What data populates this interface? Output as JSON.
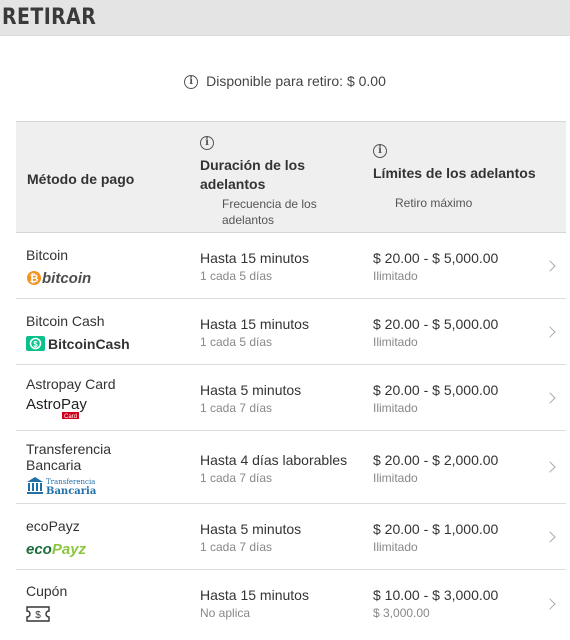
{
  "header": {
    "title": "RETIRAR"
  },
  "available": {
    "icon": "info-icon",
    "text": "Disponible para retiro: $ 0.00"
  },
  "table": {
    "columns": {
      "method": "Método de pago",
      "duration": "Duración de los adelantos",
      "duration_sub": "Frecuencia de los adelantos",
      "limits": "Límites de los adelantos",
      "limits_sub": "Retiro máximo"
    },
    "rows": [
      {
        "name": "Bitcoin",
        "logo": "bitcoin-logo",
        "duration": "Hasta 15 minutos",
        "frequency": "1 cada 5 días",
        "limits": "$ 20.00 - $ 5,000.00",
        "max": "Ilimitado"
      },
      {
        "name": "Bitcoin Cash",
        "logo": "bitcoincash-logo",
        "duration": "Hasta 15 minutos",
        "frequency": "1 cada 5 días",
        "limits": "$ 20.00 - $ 5,000.00",
        "max": "Ilimitado"
      },
      {
        "name": "Astropay Card",
        "logo": "astropay-logo",
        "duration": "Hasta 5 minutos",
        "frequency": "1 cada 7 días",
        "limits": "$ 20.00 - $ 5,000.00",
        "max": "Ilimitado"
      },
      {
        "name": "Transferencia Bancaria",
        "logo": "bank-transfer-logo",
        "duration": "Hasta 4 días laborables",
        "frequency": "1 cada 7 días",
        "limits": "$ 20.00 - $ 2,000.00",
        "max": "Ilimitado"
      },
      {
        "name": "ecoPayz",
        "logo": "ecopayz-logo",
        "duration": "Hasta 5 minutos",
        "frequency": "1 cada 7 días",
        "limits": "$ 20.00 - $ 1,000.00",
        "max": "Ilimitado"
      },
      {
        "name": "Cupón",
        "logo": "coupon-icon",
        "duration": "Hasta 15 minutos",
        "frequency": "No aplica",
        "limits": "$ 10.00 - $ 3,000.00",
        "max": "$ 3,000.00"
      }
    ]
  },
  "logos": {
    "bitcoin": {
      "text": "bitcoin"
    },
    "bitcoincash": {
      "text": "BitcoinCash"
    },
    "astropay": {
      "text": "AstroPay",
      "badge": "Card"
    },
    "bank": {
      "line1": "Transferencia",
      "line2": "Bancaria"
    },
    "ecopayz": {
      "text1": "eco",
      "text2": "Payz"
    }
  },
  "colors": {
    "header_bg": "#e4e4e4",
    "thead_bg": "#efefef",
    "bitcoin": "#f7931a",
    "bitcoincash": "#0ac18e",
    "bank": "#1f6fa8",
    "ecopayz": "#8cc63f",
    "ecopayz_dark": "#1b6d3a"
  }
}
